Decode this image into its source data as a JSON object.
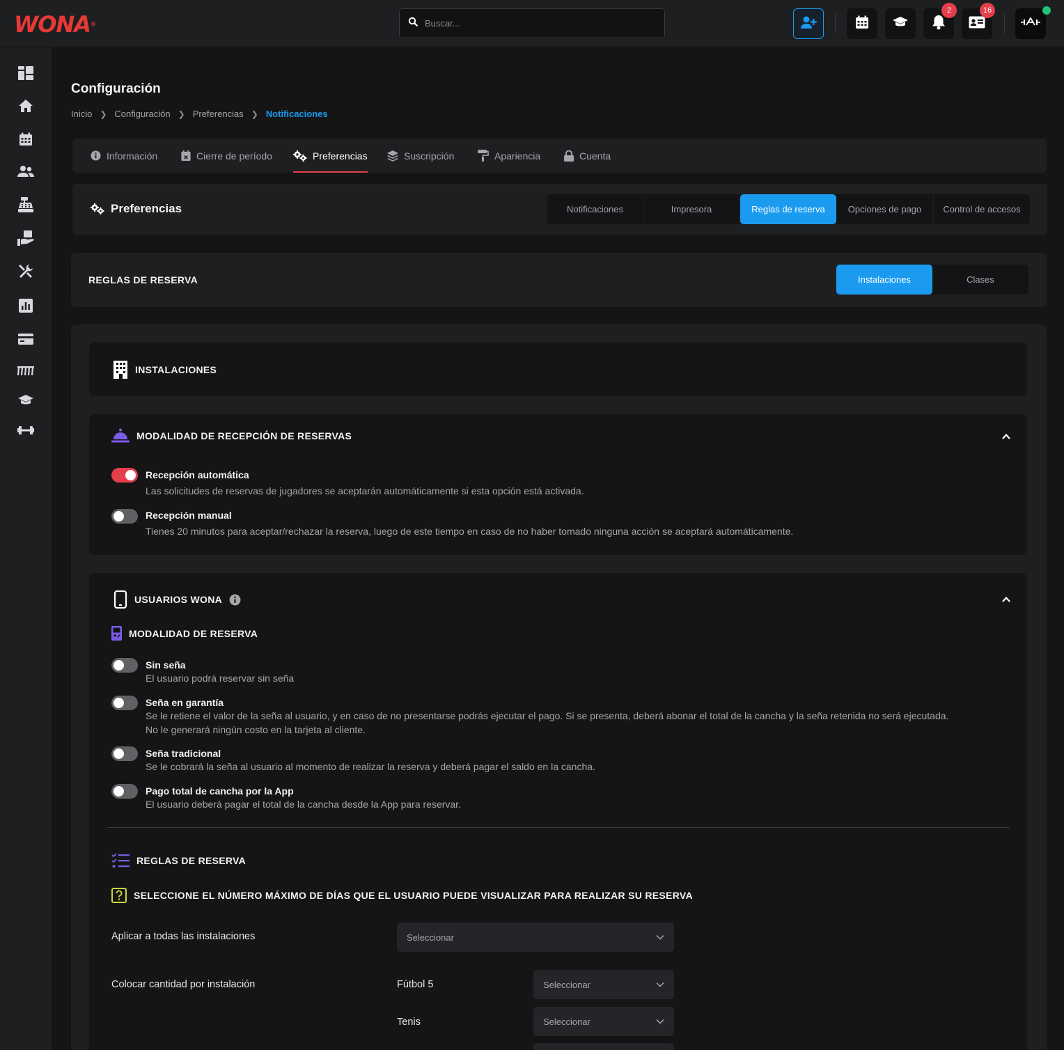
{
  "brand": {
    "logo_text": "WONA",
    "logo_mark": "®",
    "accent": "#e53935",
    "primary": "#1a9bf0"
  },
  "search": {
    "placeholder": "Buscar..."
  },
  "topbar": {
    "notifications_count": "2",
    "messages_count": "16",
    "icons": [
      "user-plus-icon",
      "calendar-icon",
      "graduation-cap-icon",
      "bell-icon",
      "id-card-icon",
      "gym-logo-icon"
    ]
  },
  "sidebar": {
    "icons": [
      "dashboard-icon",
      "home-icon",
      "calendar-icon",
      "users-icon",
      "cash-register-icon",
      "hand-holding-icon",
      "tools-icon",
      "chart-icon",
      "credit-card-icon",
      "fence-icon",
      "graduation-cap-icon",
      "dumbbell-icon"
    ]
  },
  "page": {
    "title": "Configuración",
    "breadcrumb": [
      "Inicio",
      "Configuración",
      "Preferencias",
      "Notificaciones"
    ]
  },
  "tabs": [
    {
      "label": "Información",
      "icon": "info-icon"
    },
    {
      "label": "Cierre de período",
      "icon": "calendar-x-icon"
    },
    {
      "label": "Preferencias",
      "icon": "gears-icon",
      "active": true
    },
    {
      "label": "Suscripción",
      "icon": "layers-icon"
    },
    {
      "label": "Apariencia",
      "icon": "paint-roller-icon"
    },
    {
      "label": "Cuenta",
      "icon": "lock-icon"
    }
  ],
  "preferences": {
    "title": "Preferencias",
    "segments": [
      "Notificaciones",
      "Impresora",
      "Reglas de reserva",
      "Opciones de pago",
      "Control de accesos"
    ],
    "active_segment": "Reglas de reserva"
  },
  "rules_header": {
    "title": "REGLAS DE RESERVA",
    "segments": [
      "Instalaciones",
      "Clases"
    ],
    "active_segment": "Instalaciones"
  },
  "installations": {
    "title": "INSTALACIONES"
  },
  "reception": {
    "title": "MODALIDAD DE RECEPCIÓN DE RESERVAS",
    "options": [
      {
        "title": "Recepción automática",
        "desc": "Las solicitudes de reservas de jugadores se aceptarán automáticamente si esta opción está activada.",
        "on": true
      },
      {
        "title": "Recepción manual",
        "desc": "Tienes 20 minutos para aceptar/rechazar la reserva, luego de este tiempo en caso de no haber tomado ninguna acción se aceptará automáticamente.",
        "on": false
      }
    ]
  },
  "wona_users": {
    "title": "USUARIOS WONA",
    "mode_title": "MODALIDAD DE RESERVA",
    "options": [
      {
        "title": "Sin seña",
        "desc": "El usuario podrá reservar sin seña",
        "on": false
      },
      {
        "title": "Seña en garantía",
        "desc": "Se le retiene el valor de la seña al usuario, y en caso de no presentarse podrás ejecutar el pago. Si se presenta, deberá abonar el total de la cancha y la seña retenida no será ejecutada.",
        "desc2": "No le generará ningún costo en la tarjeta al cliente.",
        "on": false
      },
      {
        "title": "Seña tradicional",
        "desc": "Se le cobrará la seña al usuario al momento de realizar la reserva y deberá pagar el saldo en la cancha.",
        "on": false
      },
      {
        "title": "Pago total de cancha por la App",
        "desc": "El usuario deberá pagar el total de la cancha desde la App para reservar.",
        "on": false
      }
    ],
    "rules_title": "REGLAS DE RESERVA",
    "question": "SELECCIONE EL NÚMERO MÁXIMO DE DÍAS QUE EL USUARIO PUEDE VISUALIZAR PARA REALIZAR SU RESERVA",
    "apply_all_label": "Aplicar a todas las instalaciones",
    "per_installation_label": "Colocar cantidad por instalación",
    "select_placeholder": "Seleccionar",
    "installations": [
      "Fútbol 5",
      "Tenis"
    ]
  }
}
